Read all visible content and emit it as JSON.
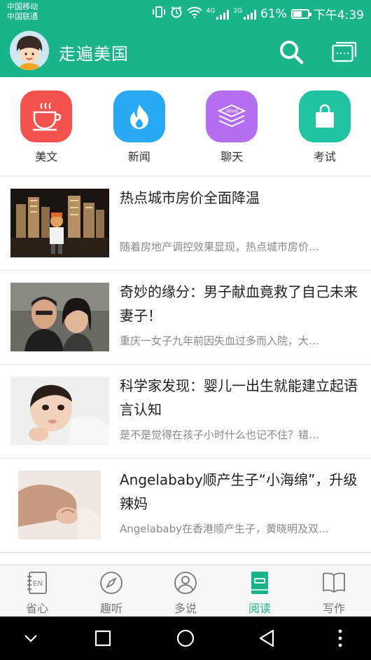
{
  "status_bar": {
    "carrier_1": "中国移动",
    "carrier_2": "中国联通",
    "net_1": "4G",
    "net_2": "2G",
    "battery": "61%",
    "battery_level": 0.61,
    "time": "下午4:39"
  },
  "app_bar": {
    "title": "走遍美国",
    "color": "#19b489",
    "icons": [
      "avatar",
      "search-icon",
      "window-icon"
    ]
  },
  "categories": [
    {
      "label": "美文",
      "icon": "coffee-cup-icon",
      "color": "#f4524d"
    },
    {
      "label": "新闻",
      "icon": "flame-icon",
      "color": "#2aa8f2"
    },
    {
      "label": "聊天",
      "icon": "word-stack-icon",
      "color": "#b56ef0",
      "icon_text": "Word"
    },
    {
      "label": "考试",
      "icon": "shopping-bag-icon",
      "color": "#1fc3a2"
    }
  ],
  "articles": [
    {
      "title": "热点城市房价全面降温",
      "summary": "随着房地产调控效果显现，热点城市房价…",
      "thumb": "city-model-photo"
    },
    {
      "title": "奇妙的缘分：男子献血竟救了自己未来妻子！",
      "summary": "重庆一女子九年前因失血过多而入院，大…",
      "thumb": "couple-selfie-photo"
    },
    {
      "title": "科学家发现：婴儿一出生就能建立起语言认知",
      "summary": "是不是觉得在孩子小时什么也记不住？错…",
      "thumb": "baby-photo"
    },
    {
      "title": "Angelababy顺产生子“小海绵”，升级辣妈",
      "summary": "Angelababy在香港顺产生子，黄晓明及双…",
      "thumb": "baby-hand-photo"
    }
  ],
  "bottom_nav": [
    {
      "label": "省心",
      "icon": "en-notebook-icon",
      "active": false
    },
    {
      "label": "趣听",
      "icon": "compass-icon",
      "active": false
    },
    {
      "label": "多说",
      "icon": "person-icon",
      "active": false
    },
    {
      "label": "阅读",
      "icon": "book-icon",
      "active": true
    },
    {
      "label": "写作",
      "icon": "open-book-icon",
      "active": false
    }
  ],
  "system_nav": [
    "collapse-icon",
    "recents-icon",
    "home-icon",
    "back-icon",
    "more-icon"
  ]
}
